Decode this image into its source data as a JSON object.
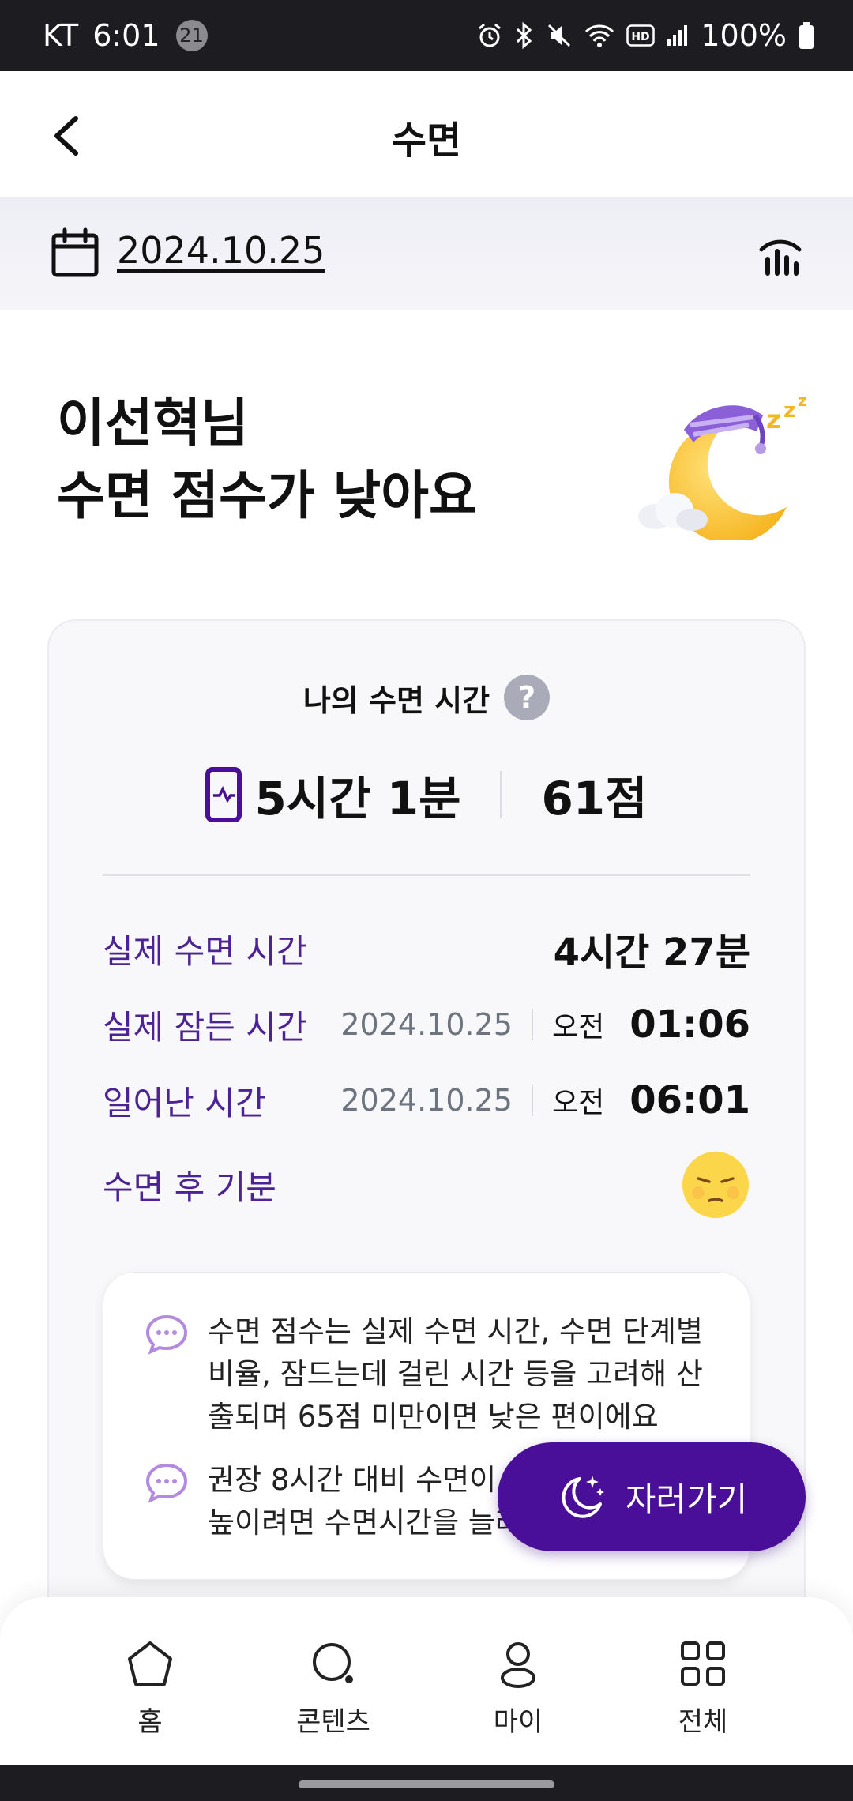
{
  "status_bar": {
    "carrier": "KT",
    "time": "6:01",
    "notification_count": "21",
    "battery": "100%",
    "icons": [
      "alarm-icon",
      "bluetooth-icon",
      "mute-icon",
      "wifi-icon",
      "hd-icon",
      "signal-icon",
      "battery-icon"
    ]
  },
  "header": {
    "title": "수면"
  },
  "date_bar": {
    "date": "2024.10.25"
  },
  "greeting": {
    "line1": "이선혁님",
    "line2": "수면 점수가 낮아요"
  },
  "card": {
    "title": "나의 수면 시간",
    "total_duration": "5시간 1분",
    "score": "61점",
    "rows": {
      "actual_sleep": {
        "label": "실제 수면 시간",
        "value": "4시간 27분"
      },
      "fell_asleep": {
        "label": "실제 잠든 시간",
        "date": "2024.10.25",
        "ampm": "오전",
        "time": "01:06"
      },
      "woke_up": {
        "label": "일어난 시간",
        "date": "2024.10.25",
        "ampm": "오전",
        "time": "06:01"
      },
      "mood": {
        "label": "수면 후 기분",
        "icon": "sleepy-face-icon"
      }
    },
    "tips": {
      "tip1": "수면 점수는 실제 수면 시간, 수면 단계별 비율, 잠드는데 걸린 시간 등을 고려해 산출되며 65점 미만이면 낮은 편이에요",
      "tip2_line1": "권장 8시간 대비 수면이 부",
      "tip2_line2": "높이려면 수면시간을 늘려"
    }
  },
  "fab": {
    "label": "자러가기"
  },
  "bottom_nav": {
    "home": "홈",
    "contents": "콘텐츠",
    "my": "마이",
    "all": "전체"
  },
  "colors": {
    "accent": "#4a0f98",
    "label_purple": "#4b2394",
    "statusbar": "#1c1c21"
  }
}
